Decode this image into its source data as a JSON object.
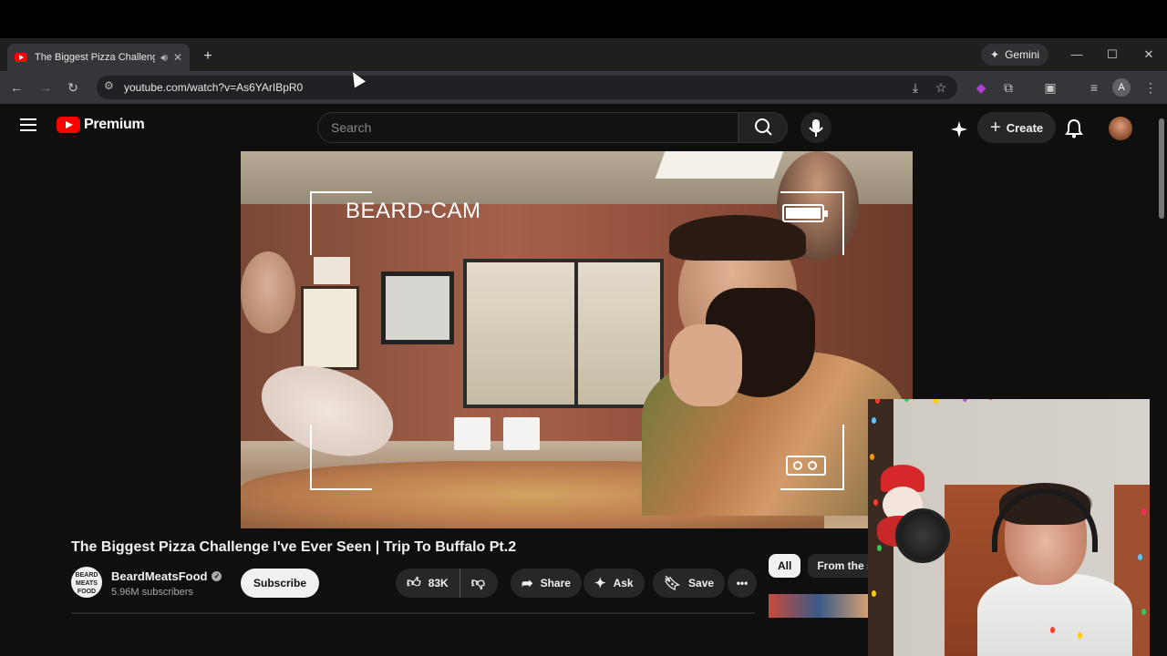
{
  "browser": {
    "tab_title": "The Biggest Pizza Challeng",
    "url": "youtube.com/watch?v=As6YArIBpR0",
    "gemini_label": "Gemini",
    "profile_initial": "A"
  },
  "youtube": {
    "logo_text": "Premium",
    "search_placeholder": "Search",
    "create_label": "Create"
  },
  "video": {
    "overlay_text": "BEARD-CAM",
    "title": "The Biggest Pizza Challenge I've Ever Seen | Trip To Buffalo Pt.2",
    "channel_name": "BeardMeatsFood",
    "channel_avatar_text": "BEARD MEATS FOOD",
    "subscribers": "5.96M subscribers",
    "subscribe_label": "Subscribe",
    "likes": "83K",
    "share_label": "Share",
    "ask_label": "Ask",
    "save_label": "Save"
  },
  "filters": [
    "All",
    "From the s"
  ],
  "colors": {
    "youtube_red": "#ff0000",
    "page_bg": "#0f0f0f",
    "chip_bg": "#272727"
  },
  "icons": {
    "back": "arrow-left-icon",
    "forward": "arrow-right-icon",
    "reload": "reload-icon",
    "site_settings": "tune-icon",
    "install": "install-icon",
    "bookmark": "star-icon",
    "extensions": "puzzle-icon",
    "menu": "hamburger-icon",
    "search": "search-icon",
    "mic": "mic-icon",
    "notifications": "bell-icon"
  }
}
